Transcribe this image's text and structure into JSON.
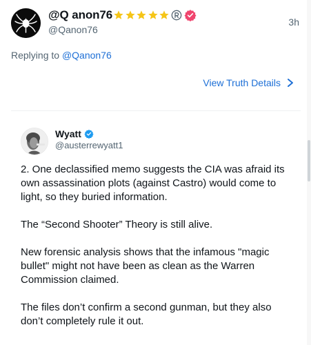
{
  "post": {
    "author_name": "@Q anon76",
    "author_handle": "@Qanon76",
    "timestamp": "3h",
    "badges": {
      "stars": [
        "star-icon",
        "star-icon",
        "star-icon",
        "star-icon",
        "star-icon"
      ],
      "star_color": "#f5c518",
      "registered": "registered-mark-icon",
      "verified": "pink-verified-badge-icon",
      "verified_color": "#f0456e"
    }
  },
  "reply": {
    "prefix": "Replying to ",
    "mention": "@Qanon76"
  },
  "actions": {
    "view_details": "View Truth Details"
  },
  "embedded": {
    "author_name": "Wyatt",
    "author_handle": "@austerrewyatt1",
    "verified_icon": "blue-verified-badge-icon",
    "verified_color": "#1d9bf0",
    "paragraphs": [
      "2. One declassified memo suggests the CIA was afraid its own assassination plots (against Castro) would come to light, so they buried information.",
      "The “Second Shooter” Theory is still alive.",
      "New forensic analysis shows that the infamous \"magic bullet\" might not have been as clean as the Warren Commission claimed.",
      "The files don’t confirm a second gunman, but they also don’t completely rule it out."
    ]
  },
  "colors": {
    "link": "#1d6fd6",
    "muted": "#536471",
    "text": "#0f1419"
  }
}
